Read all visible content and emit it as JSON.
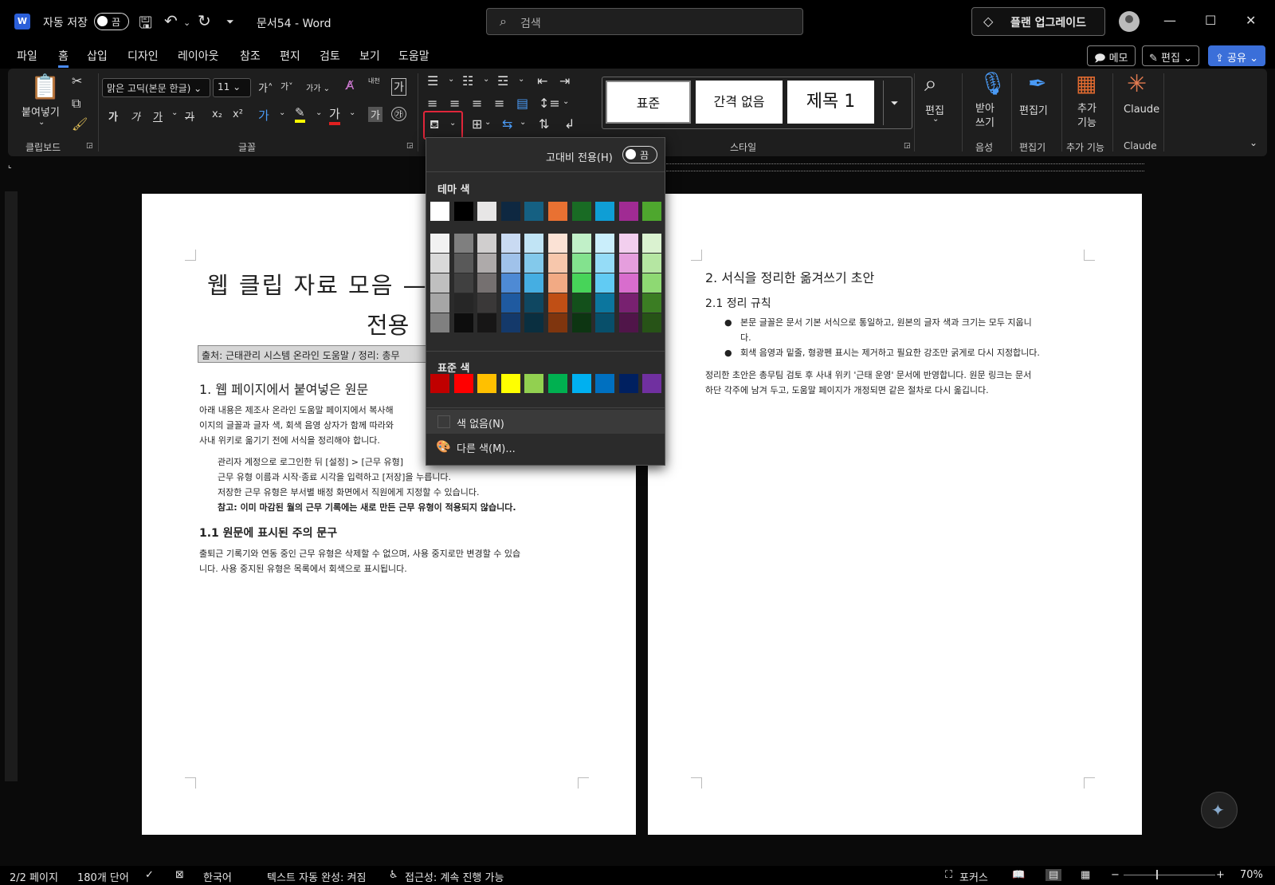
{
  "titlebar": {
    "autosave_label": "자동 저장",
    "autosave_state": "끔",
    "doc_title": "문서54  -  Word",
    "search_placeholder": "검색",
    "upgrade_label": "플랜 업그레이드"
  },
  "menu": {
    "items": [
      "파일",
      "홈",
      "삽입",
      "디자인",
      "레이아웃",
      "참조",
      "편지",
      "검토",
      "보기",
      "도움말"
    ],
    "memo": "메모",
    "edit": "편집",
    "share": "공유"
  },
  "ribbon": {
    "clipboard": {
      "paste": "붙여넣기",
      "label": "클립보드"
    },
    "font": {
      "name": "맑은 고딕(본문 한글)",
      "size": "11",
      "label": "글꼴",
      "phonetic": "내천",
      "row1": [
        "가",
        "가",
        "가",
        "가",
        "가"
      ],
      "row2": [
        "가",
        "가",
        "가",
        "가",
        "x₂",
        "x²",
        "가",
        "가"
      ]
    },
    "styles": {
      "items": [
        "표준",
        "간격 없음",
        "제목 1"
      ],
      "label": "스타일"
    },
    "editing": {
      "label": "편집"
    },
    "dictate": {
      "label": "받아\n쓰기",
      "group": "음성"
    },
    "editor": {
      "label": "편집기",
      "group": "편집기"
    },
    "addins": {
      "label": "추가\n기능",
      "group": "추가 기능"
    },
    "claude": {
      "label": "Claude",
      "group": "Claude"
    }
  },
  "page1": {
    "title_line1": "웹 클립 자료 모음 —",
    "title_line2": "전용",
    "source": "출처: 근태관리 시스템 온라인 도움말 / 정리: 총무",
    "h1": "1. 웹 페이지에서 붙여넣은 원문",
    "p1": [
      "아래 내용은 제조사 온라인 도움말 페이지에서 복사해",
      "이지의 글꼴과 글자 색, 회색 음영 상자가 함께 따라와",
      "사내 위키로 옮기기 전에 서식을 정리해야 합니다."
    ],
    "steps": [
      "관리자 계정으로 로그인한 뒤 [설정] > [근무 유형]",
      "근무 유형 이름과 시작·종료 시각을 입력하고 [저장]을 누릅니다.",
      "저장한 근무 유형은 부서별 배정 화면에서 직원에게 지정할 수 있습니다."
    ],
    "note": "참고: 이미 마감된 월의 근무 기록에는 새로 만든 근무 유형이 적용되지 않습니다.",
    "h2": "1.1 원문에 표시된 주의 문구",
    "p2": [
      "출퇴근 기록기와 연동 중인 근무 유형은 삭제할 수 없으며, 사용 중지로만 변경할 수 있습",
      "니다. 사용 중지된 유형은 목록에서 회색으로 표시됩니다."
    ]
  },
  "page2": {
    "h1": "2. 서식을 정리한 옮겨쓰기 초안",
    "h2": "2.1 정리 규칙",
    "bullets": [
      [
        "본문 글꼴은 문서 기본 서식으로 통일하고, 원본의 글자 색과 크기는 모두 지웁니",
        "다."
      ],
      [
        "회색 음영과 밑줄, 형광펜 표시는 제거하고 필요한 강조만 굵게로 다시 지정합니다."
      ]
    ],
    "p": [
      "정리한 초안은 총무팀 검토 후 사내 위키 '근태 운영' 문서에 반영합니다. 원문 링크는 문서",
      "하단 각주에 남겨 두고, 도움말 페이지가 개정되면 같은 절차로 다시 옮깁니다."
    ]
  },
  "dropdown": {
    "high_contrast": "고대비 전용(H)",
    "hc_state": "끔",
    "theme_title": "테마 색",
    "standard_title": "표준 색",
    "no_color": "색 없음(N)",
    "more_colors": "다른 색(M)...",
    "theme_top": [
      "#ffffff",
      "#000000",
      "#e7e6e6",
      "#0e2841",
      "#156082",
      "#e97132",
      "#196b24",
      "#0f9ed5",
      "#a02b93",
      "#4ea72e"
    ],
    "theme_shades": [
      [
        "#f2f2f2",
        "#d9d9d9",
        "#bfbfbf",
        "#a6a6a6",
        "#808080"
      ],
      [
        "#7f7f7f",
        "#595959",
        "#404040",
        "#262626",
        "#0d0d0d"
      ],
      [
        "#d0cece",
        "#aeaaaa",
        "#757070",
        "#3a3838",
        "#171616"
      ],
      [
        "#c9daf2",
        "#a0c2ea",
        "#4e8ad4",
        "#1f5aa0",
        "#14396a"
      ],
      [
        "#c1e4f5",
        "#83c9eb",
        "#45aee2",
        "#0f4761",
        "#0a2f40"
      ],
      [
        "#fbe2d5",
        "#f7c7ac",
        "#f2aa84",
        "#c04f15",
        "#7f350e"
      ],
      [
        "#c1f0c8",
        "#83e28e",
        "#47d459",
        "#13501b",
        "#0d3512"
      ],
      [
        "#caeefb",
        "#95dcf7",
        "#61cbf3",
        "#0c769e",
        "#084f6a"
      ],
      [
        "#f2cfee",
        "#e59edd",
        "#d86dcd",
        "#782170",
        "#501549"
      ],
      [
        "#daf2d0",
        "#b5e6a2",
        "#8ed973",
        "#3b7d23",
        "#275317"
      ]
    ],
    "standard": [
      "#c00000",
      "#ff0000",
      "#ffc000",
      "#ffff00",
      "#92d050",
      "#00b050",
      "#00b0f0",
      "#0070c0",
      "#002060",
      "#7030a0"
    ]
  },
  "status": {
    "page": "2/2 페이지",
    "words": "180개 단어",
    "lang": "한국어",
    "autocomplete": "텍스트 자동 완성: 켜짐",
    "accessibility": "접근성: 계속 진행 가능",
    "focus": "포커스",
    "zoom": "70%"
  }
}
